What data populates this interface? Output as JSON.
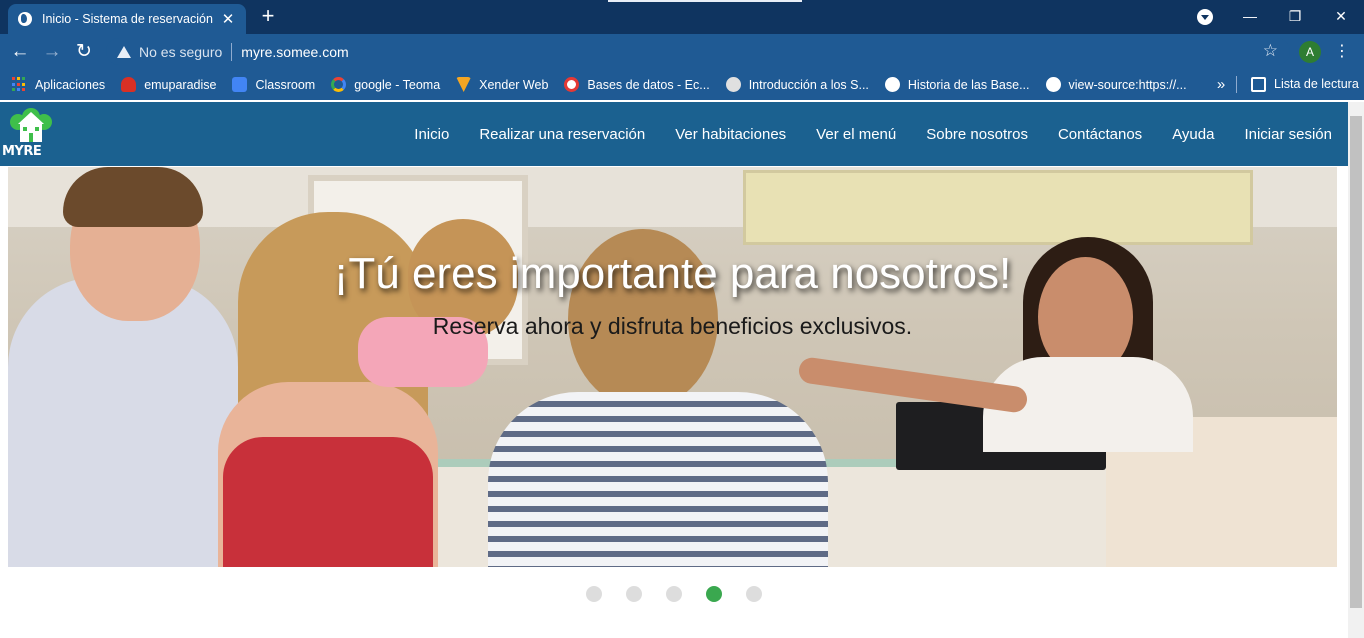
{
  "browser": {
    "tab": {
      "title": "Inicio - Sistema de reservación",
      "close_glyph": "✕"
    },
    "new_tab_glyph": "+",
    "window_controls": {
      "minimize": "—",
      "restore": "❐",
      "close": "✕"
    },
    "nav": {
      "back": "←",
      "forward": "→",
      "reload": "↻"
    },
    "omnibox": {
      "security_text": "No es seguro",
      "url": "myre.somee.com",
      "star": "☆"
    },
    "profile_initial": "A",
    "menu_glyph": "⋮",
    "bookmarks": [
      {
        "label": "Aplicaciones",
        "icon": "apps-grid-icon"
      },
      {
        "label": "emuparadise",
        "icon": "mushroom-icon",
        "color": "#d93025"
      },
      {
        "label": "Classroom",
        "icon": "classroom-icon",
        "color": "#4285f4"
      },
      {
        "label": "google - Teoma",
        "icon": "google-icon",
        "color": "#34a853"
      },
      {
        "label": "Xender Web",
        "icon": "xender-icon",
        "color": "#f5a623"
      },
      {
        "label": "Bases de datos - Ec...",
        "icon": "ecured-icon",
        "color": "#e53935"
      },
      {
        "label": "Introducción a los S...",
        "icon": "gear-icon",
        "color": "#e0e0e0"
      },
      {
        "label": "Historia de las Base...",
        "icon": "globe-icon",
        "color": "#ffffff"
      },
      {
        "label": "view-source:https://...",
        "icon": "globe-icon",
        "color": "#ffffff"
      }
    ],
    "bookmarks_more": "»",
    "reading_list": "Lista de lectura"
  },
  "site": {
    "logo_text": "MYRE",
    "menu": [
      "Inicio",
      "Realizar una reservación",
      "Ver habitaciones",
      "Ver el menú",
      "Sobre nosotros",
      "Contáctanos",
      "Ayuda",
      "Iniciar sesión"
    ],
    "hero": {
      "headline": "¡Tú eres importante para nosotros!",
      "subheadline": "Reserva ahora y disfruta beneficios exclusivos."
    },
    "carousel": {
      "slides": 5,
      "active_index": 3
    }
  },
  "colors": {
    "chrome_dark": "#0f3460",
    "chrome": "#1f5a94",
    "site_nav": "#1b6190",
    "carousel_active": "#3aa84f",
    "carousel_idle": "#dddddd"
  }
}
